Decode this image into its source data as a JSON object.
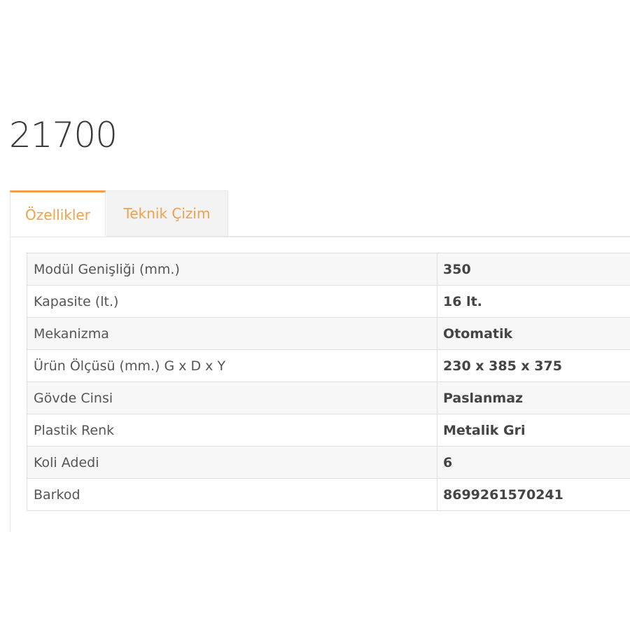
{
  "product": {
    "title": "21700"
  },
  "tabs": [
    {
      "label": "Özellikler",
      "active": true
    },
    {
      "label": "Teknik Çizim",
      "active": false
    }
  ],
  "specs": [
    {
      "label": "Modül Genişliği (mm.)",
      "value": "350"
    },
    {
      "label": "Kapasite (lt.)",
      "value": "16 lt."
    },
    {
      "label": "Mekanizma",
      "value": "Otomatik"
    },
    {
      "label": "Ürün Ölçüsü (mm.) G x D x Y",
      "value": "230 x 385 x 375"
    },
    {
      "label": "Gövde Cinsi",
      "value": "Paslanmaz"
    },
    {
      "label": "Plastik Renk",
      "value": "Metalik Gri"
    },
    {
      "label": "Koli Adedi",
      "value": "6"
    },
    {
      "label": "Barkod",
      "value": "8699261570241"
    }
  ],
  "colors": {
    "accent": "#f0a04a",
    "text": "#555555",
    "row_alt": "#f7f7f7",
    "border": "#dedede"
  }
}
